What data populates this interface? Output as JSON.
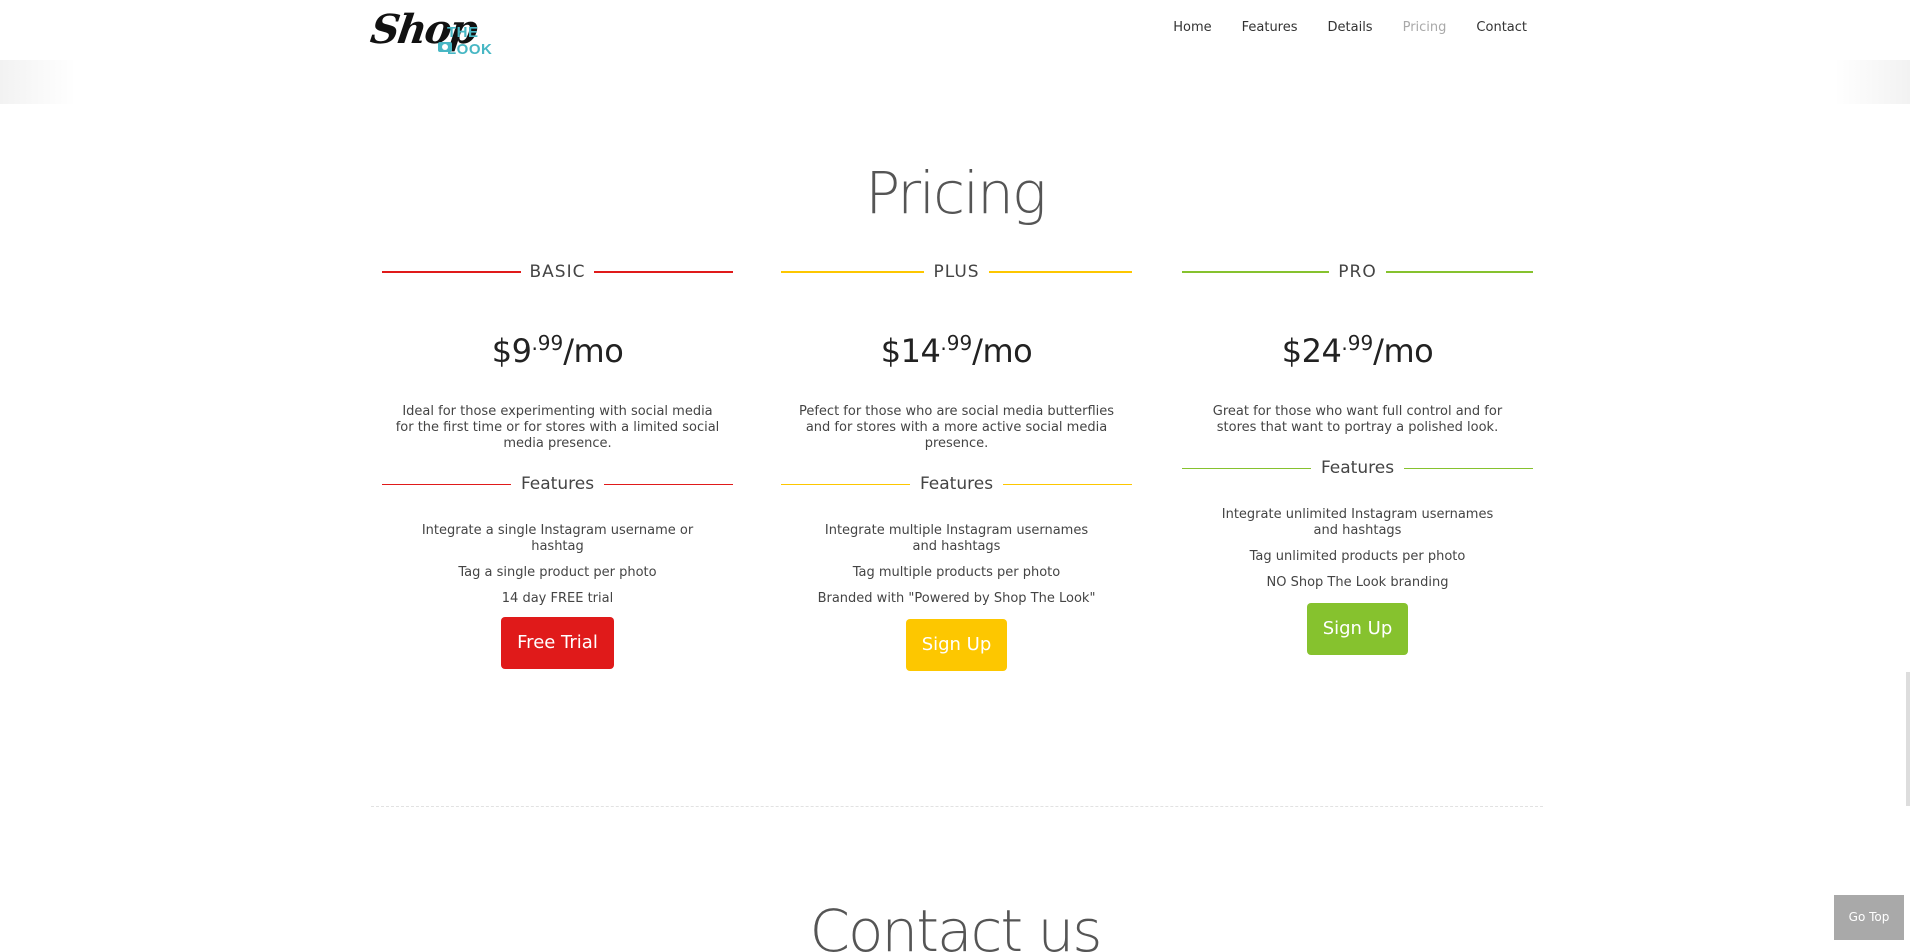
{
  "logo": {
    "script": "Shop",
    "sub": "THE LOOK"
  },
  "nav": {
    "items": [
      {
        "label": "Home"
      },
      {
        "label": "Features"
      },
      {
        "label": "Details"
      },
      {
        "label": "Pricing"
      },
      {
        "label": "Contact"
      }
    ],
    "active": "Pricing"
  },
  "pricing": {
    "title": "Pricing",
    "features_heading": "Features",
    "plans": [
      {
        "name": "BASIC",
        "price_main": "$9",
        "price_cents": ".99",
        "price_period": "/mo",
        "description": "Ideal for those experimenting with social media for the first time or for stores with a limited social media presence.",
        "features": [
          "Integrate a single Instagram username or hashtag",
          "Tag a single product per photo",
          "14 day FREE trial"
        ],
        "cta": "Free Trial",
        "color": "#e01a1a"
      },
      {
        "name": "PLUS",
        "price_main": "$14",
        "price_cents": ".99",
        "price_period": "/mo",
        "description": "Pefect for those who are social media butterflies and for stores with a more active social media presence.",
        "features": [
          "Integrate multiple Instagram usernames and hashtags",
          "Tag multiple products per photo",
          "Branded with \"Powered by Shop The Look\""
        ],
        "cta": "Sign Up",
        "color": "#fdc700"
      },
      {
        "name": "PRO",
        "price_main": "$24",
        "price_cents": ".99",
        "price_period": "/mo",
        "description": "Great for those who want full control and for stores that want to portray a polished look.",
        "features": [
          "Integrate unlimited Instagram usernames and hashtags",
          "Tag unlimited products per photo",
          "NO Shop The Look branding"
        ],
        "cta": "Sign Up",
        "color": "#86c22e"
      }
    ]
  },
  "contact": {
    "title": "Contact us"
  },
  "go_top": {
    "label": "Go Top"
  },
  "colors": {
    "brand_teal": "#47b7c4",
    "nav_active": "#a9a9a9",
    "go_top_bg": "#a9a9a9"
  }
}
